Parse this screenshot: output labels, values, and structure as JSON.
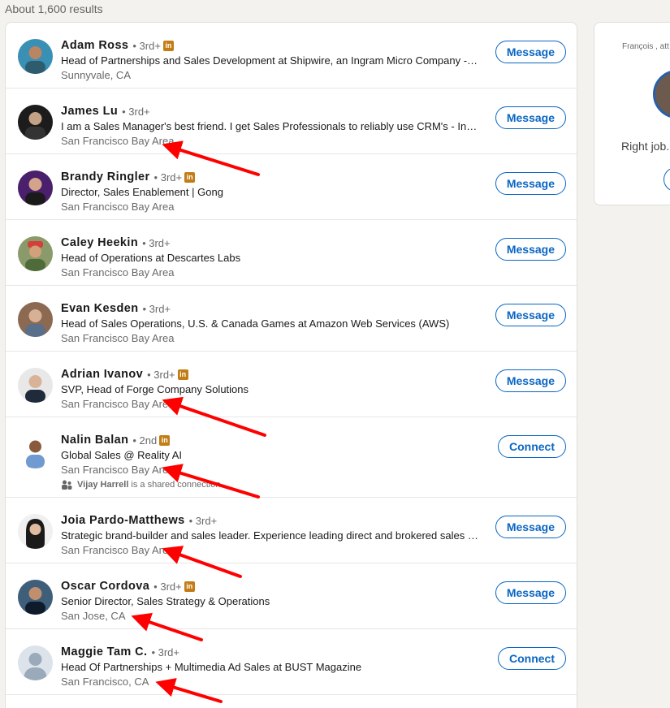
{
  "results_count": "About 1,600 results",
  "results": [
    {
      "name": "Adam Ross",
      "degree": "• 3rd+",
      "premium": true,
      "headline": "Head of Partnerships and Sales Development at Shipwire, an Ingram Micro Company -- e…",
      "location": "Sunnyvale, CA",
      "action": "Message"
    },
    {
      "name": "James Lu",
      "degree": "• 3rd+",
      "premium": false,
      "headline": "I am a Sales Manager's best friend. I get Sales Professionals to reliably use CRM's - Indir…",
      "location": "San Francisco Bay Area",
      "action": "Message"
    },
    {
      "name": "Brandy Ringler",
      "degree": "• 3rd+",
      "premium": true,
      "headline": "Director, Sales Enablement | Gong",
      "location": "San Francisco Bay Area",
      "action": "Message"
    },
    {
      "name": "Caley Heekin",
      "degree": "• 3rd+",
      "premium": false,
      "headline": "Head of Operations at Descartes Labs",
      "location": "San Francisco Bay Area",
      "action": "Message"
    },
    {
      "name": "Evan Kesden",
      "degree": "• 3rd+",
      "premium": false,
      "headline": "Head of Sales Operations, U.S. & Canada Games at Amazon Web Services (AWS)",
      "location": "San Francisco Bay Area",
      "action": "Message"
    },
    {
      "name": "Adrian Ivanov",
      "degree": "• 3rd+",
      "premium": true,
      "headline": "SVP, Head of Forge Company Solutions",
      "location": "San Francisco Bay Area",
      "action": "Message"
    },
    {
      "name": "Nalin Balan",
      "degree": "• 2nd",
      "premium": true,
      "headline": "Global Sales @ Reality AI",
      "location": "San Francisco Bay Area",
      "action": "Connect",
      "shared_name": "Vijay Harrell",
      "shared_text": "is a shared connection"
    },
    {
      "name": "Joia Pardo-Matthews",
      "degree": "• 3rd+",
      "premium": false,
      "headline": "Strategic brand-builder and sales leader. Experience leading direct and brokered sales te…",
      "location": "San Francisco Bay Area",
      "action": "Message"
    },
    {
      "name": "Oscar Cordova",
      "degree": "• 3rd+",
      "premium": true,
      "headline": "Senior Director, Sales Strategy & Operations",
      "location": "San Jose, CA",
      "action": "Message"
    },
    {
      "name": "Maggie Tam C.",
      "degree": "• 3rd+",
      "premium": false,
      "headline": "Head Of Partnerships + Multimedia Ad Sales at BUST Magazine",
      "location": "San Francisco, CA",
      "action": "Connect"
    }
  ],
  "premium_badge": "in",
  "side_card": {
    "ad_text": "François , att",
    "body_text": "Right job."
  },
  "colors": {
    "accent": "#0a66c2",
    "premium": "#c37d16",
    "annotation": "#ff0000"
  }
}
